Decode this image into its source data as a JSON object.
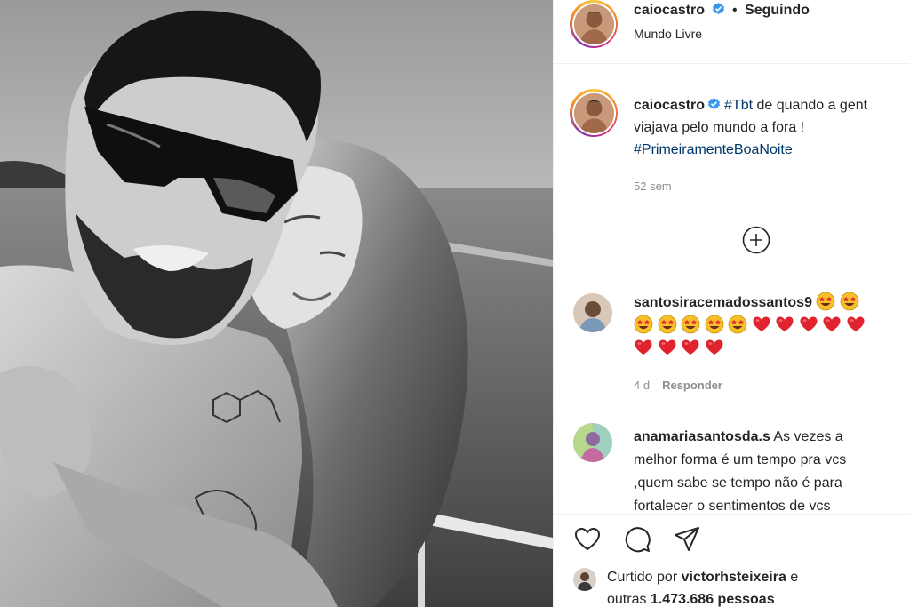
{
  "post": {
    "username": "caiocastro",
    "separator": "•",
    "follow_status": "Seguindo",
    "location": "Mundo Livre"
  },
  "caption": {
    "username": "caiocastro",
    "line1_tag": "#Tbt",
    "line1_rest": " de quando a gent",
    "line2": "viajava pelo mundo a fora !",
    "line3_tag": "#PrimeiramenteBoaNoite",
    "time": "52 sem"
  },
  "comments": [
    {
      "username": "santosiracemadossantos9",
      "time": "4 d",
      "reply_label": "Responder"
    },
    {
      "username": "anamariasantosda.s",
      "line1": " As vezes a",
      "line2": "melhor forma é um tempo pra vcs",
      "line3": ",quem sabe se tempo não é para",
      "line4": "fortalecer o sentimentos de vcs"
    }
  ],
  "likes": {
    "prefix": "Curtido por ",
    "user": "victorhsteixeira",
    "mid": " e",
    "line2_prefix": "outras ",
    "count": "1.473.686 pessoas"
  },
  "icons": {
    "verified": "verified-badge-icon",
    "more": "plus-circle-icon",
    "like": "heart-icon",
    "comment": "comment-bubble-icon",
    "share": "paper-plane-icon"
  },
  "colors": {
    "hashtag": "#00376b",
    "verified": "#3897f0",
    "heart_red": "#e0242f",
    "muted": "#8e8e8e"
  }
}
